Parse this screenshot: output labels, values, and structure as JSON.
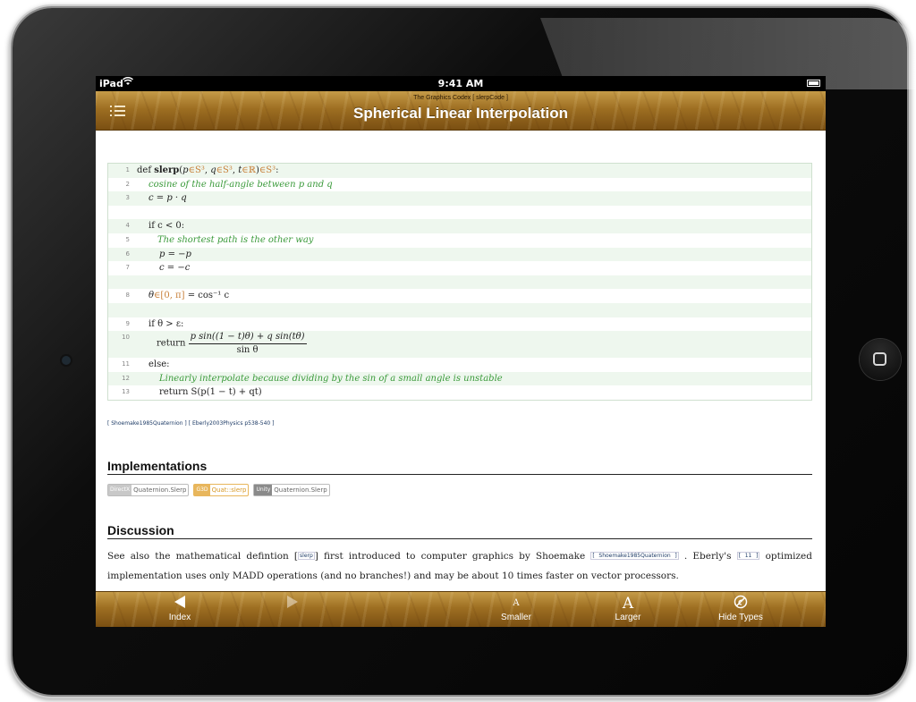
{
  "statusbar": {
    "carrier": "iPad",
    "time": "9:41 AM"
  },
  "navbar": {
    "subtitle": "The Graphics Codex [ slerpCode ]",
    "title": "Spherical Linear Interpolation"
  },
  "code": {
    "line_numbers": [
      "1",
      "2",
      "3",
      "4",
      "5",
      "6",
      "7",
      "8",
      "9",
      "10",
      "11",
      "12",
      "13"
    ],
    "l1": {
      "def": "def ",
      "name": "slerp",
      "open": "(",
      "p": "p",
      "s3a": "∈S³",
      "c1": ", ",
      "q": "q",
      "s3b": "∈S³",
      "c2": ", ",
      "t": "t",
      "r": "∈ℝ",
      "close": ")",
      "s3c": "∈S³",
      "colon": ":"
    },
    "l2": "cosine of the half-angle between p and q",
    "l3": "c = p · q",
    "l4": "if c < 0:",
    "l5": "The shortest path is the other way",
    "l6": "p = −p",
    "l7": "c = −c",
    "l8": {
      "theta": "θ",
      "range": "∈[0, π]",
      "rest": " = cos⁻¹ c"
    },
    "l9": "if θ > ε:",
    "l10": {
      "ret": "return ",
      "num": "p sin((1 − t)θ) + q sin(tθ)",
      "den": "sin θ"
    },
    "l11": "else:",
    "l12": "Linearly interpolate because dividing by the sin of a small angle is unstable",
    "l13": "return S(p(1 − t) + qt)"
  },
  "refs": [
    "[ Shoemake1985Quaternion ]",
    "[ Eberly2003Physics p538-540 ]"
  ],
  "implementations": {
    "heading": "Implementations",
    "tags": [
      {
        "badge": "DirectX",
        "label": "Quaternion.Slerp"
      },
      {
        "badge": "G3D",
        "label": "Quat::slerp"
      },
      {
        "badge": "Unity",
        "label": "Quaternion.Slerp"
      }
    ]
  },
  "discussion": {
    "heading": "Discussion",
    "t1": "See also the mathematical defintion [",
    "slerp_link": "slerp",
    "t2": "] first introduced to computer graphics by Shoemake ",
    "cite1": "[ Shoemake1985Quaternion ]",
    "t3": " . Eberly's ",
    "cite2": "[ 11 ]",
    "t4": " optimized implementation uses only MADD operations (and no branches!) and may be about 10 times faster on vector processors."
  },
  "toolbar": {
    "index_label": "Index",
    "smaller_glyph": "A",
    "smaller_label": "Smaller",
    "larger_glyph": "A",
    "larger_label": "Larger",
    "hide_label": "Hide Types"
  },
  "colors": {
    "accent": "#9e6f22",
    "comment": "#3a9a3a",
    "type": "#c8803a",
    "code_bg": "#eef7ee"
  }
}
